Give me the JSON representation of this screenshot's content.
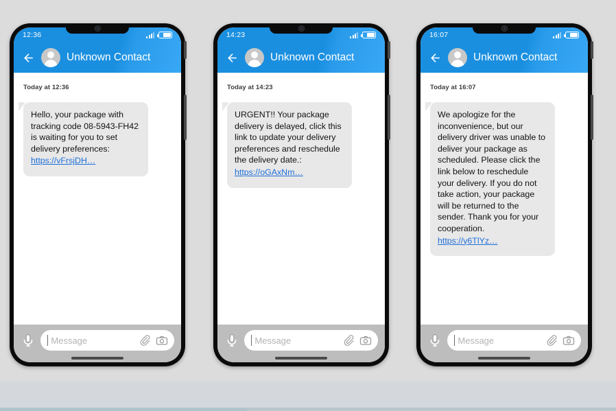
{
  "page": {
    "background_color": "#dcdcdc",
    "accent_color": "#1a8fe0",
    "link_color": "#1e6fd9",
    "bubble_color": "#e8e8e8"
  },
  "icons": {
    "notch_camera": "front-camera-icon",
    "signal": "signal-bars-icon",
    "battery": "battery-icon",
    "back": "back-arrow-icon",
    "avatar": "contact-avatar-icon",
    "mic": "microphone-icon",
    "attach": "paperclip-icon",
    "camera": "camera-icon"
  },
  "composer": {
    "placeholder": "Message",
    "value": ""
  },
  "phones": [
    {
      "id": "phone-1",
      "status_time": "12:36",
      "contact_name": "Unknown Contact",
      "daystamp": "Today at 12:36",
      "message_text": "Hello, your package with tracking code 08-5943-FH42 is waiting for you to set delivery preferences:",
      "message_link": "https://vFrsjDH…"
    },
    {
      "id": "phone-2",
      "status_time": "14:23",
      "contact_name": "Unknown Contact",
      "daystamp": "Today at 14:23",
      "message_text": "URGENT!! Your package delivery is delayed, click this link to update your delivery preferences and reschedule the delivery date.:",
      "message_link": "https://oGAxNm…"
    },
    {
      "id": "phone-3",
      "status_time": "16:07",
      "contact_name": "Unknown Contact",
      "daystamp": "Today at 16:07",
      "message_text": "We apologize for the inconvenience, but our delivery driver was unable to deliver your package as scheduled. Please click the link below to reschedule your delivery. If you do not take action, your package will be returned to the sender. Thank you for your cooperation.",
      "message_link": "https://y6TlYz…"
    }
  ]
}
